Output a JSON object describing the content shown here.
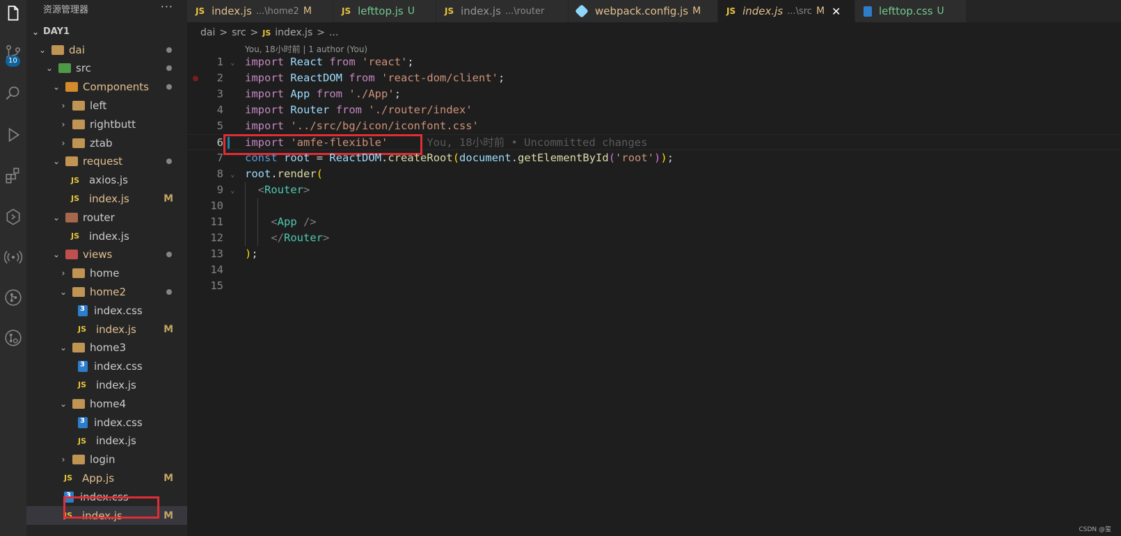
{
  "sidebar": {
    "title": "资源管理器",
    "more": "···",
    "workspace": "DAY1",
    "tree": [
      {
        "label": "dai",
        "kind": "folder",
        "indent": 1,
        "open": true,
        "dot": true
      },
      {
        "label": "src",
        "kind": "folder-green",
        "indent": 2,
        "open": true,
        "dot": true
      },
      {
        "label": "Components",
        "kind": "folder-orange",
        "indent": 3,
        "open": true,
        "dot": true
      },
      {
        "label": "left",
        "kind": "folder",
        "indent": 4,
        "open": false
      },
      {
        "label": "rightbutt",
        "kind": "folder",
        "indent": 4,
        "open": false
      },
      {
        "label": "ztab",
        "kind": "folder",
        "indent": 4,
        "open": false
      },
      {
        "label": "request",
        "kind": "folder",
        "indent": 3,
        "open": true,
        "dot": true
      },
      {
        "label": "axios.js",
        "kind": "js",
        "indent": 4
      },
      {
        "label": "index.js",
        "kind": "js",
        "indent": 4,
        "flag": "M"
      },
      {
        "label": "router",
        "kind": "folder-router",
        "indent": 3,
        "open": true
      },
      {
        "label": "index.js",
        "kind": "js",
        "indent": 4
      },
      {
        "label": "views",
        "kind": "folder-red",
        "indent": 3,
        "open": true,
        "dot": true
      },
      {
        "label": "home",
        "kind": "folder",
        "indent": 4,
        "open": false
      },
      {
        "label": "home2",
        "kind": "folder",
        "indent": 4,
        "open": true,
        "dot": true
      },
      {
        "label": "index.css",
        "kind": "css",
        "indent": 5
      },
      {
        "label": "index.js",
        "kind": "js",
        "indent": 5,
        "flag": "M"
      },
      {
        "label": "home3",
        "kind": "folder",
        "indent": 4,
        "open": true
      },
      {
        "label": "index.css",
        "kind": "css",
        "indent": 5
      },
      {
        "label": "index.js",
        "kind": "js",
        "indent": 5
      },
      {
        "label": "home4",
        "kind": "folder",
        "indent": 4,
        "open": true
      },
      {
        "label": "index.css",
        "kind": "css",
        "indent": 5
      },
      {
        "label": "index.js",
        "kind": "js",
        "indent": 5
      },
      {
        "label": "login",
        "kind": "folder",
        "indent": 4,
        "open": false
      },
      {
        "label": "App.js",
        "kind": "js",
        "indent": 3,
        "flag": "M"
      },
      {
        "label": "index.css",
        "kind": "css",
        "indent": 3
      },
      {
        "label": "index.js",
        "kind": "js",
        "indent": 3,
        "flag": "M",
        "active": true
      }
    ]
  },
  "activity": {
    "badge": "10",
    "icons": [
      "explorer-icon",
      "source-control-icon",
      "search-icon",
      "run-debug-icon",
      "extensions-icon",
      "remote-explorer-icon",
      "broadcast-icon",
      "git-graph-icon",
      "gitlens-icon"
    ]
  },
  "tabs": [
    {
      "label": "index.js",
      "desc": "...\\home2",
      "flag": "M",
      "kind": "js"
    },
    {
      "label": "lefttop.js",
      "desc": "",
      "flag": "U",
      "kind": "js"
    },
    {
      "label": "index.js",
      "desc": "...\\router",
      "flag": "",
      "kind": "js"
    },
    {
      "label": "webpack.config.js",
      "desc": "",
      "flag": "M",
      "kind": "webpack"
    },
    {
      "label": "index.js",
      "desc": "...\\src",
      "flag": "M",
      "kind": "js",
      "active": true
    },
    {
      "label": "lefttop.css",
      "desc": "",
      "flag": "U",
      "kind": "css"
    }
  ],
  "breadcrumb": {
    "parts": [
      "dai",
      "src",
      "index.js",
      "..."
    ],
    "js_badge": "JS",
    "sep": ">"
  },
  "editor": {
    "codelens": "You, 18小时前 | 1 author (You)",
    "blame": "You, 18小时前 • Uncommitted changes",
    "current_line": 6,
    "line_numbers": [
      "1",
      "2",
      "3",
      "4",
      "5",
      "6",
      "7",
      "8",
      "9",
      "10",
      "11",
      "12",
      "13",
      "14",
      "15"
    ]
  },
  "labels": {
    "js": "JS",
    "folder_open": "⌄",
    "folder_closed": "›",
    "close": "✕"
  },
  "watermark": "CSDN @玺"
}
